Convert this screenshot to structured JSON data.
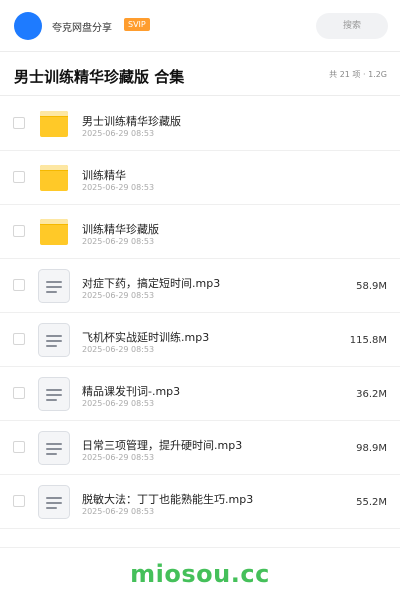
{
  "header": {
    "user_name": "夸克网盘分享",
    "badge": "SVIP",
    "search_placeholder": "搜索"
  },
  "share": {
    "title": "男士训练精华珍藏版 合集",
    "meta": "共 21 项 · 1.2G"
  },
  "files": [
    {
      "type": "folder",
      "name": "男士训练精华珍藏版",
      "date": "2025-06-29 08:53",
      "size": ""
    },
    {
      "type": "folder",
      "name": "训练精华",
      "date": "2025-06-29 08:53",
      "size": ""
    },
    {
      "type": "folder",
      "name": "训练精华珍藏版",
      "date": "2025-06-29 08:53",
      "size": ""
    },
    {
      "type": "file",
      "name": "对症下药，搞定短时间.mp3",
      "date": "2025-06-29 08:53",
      "size": "58.9M"
    },
    {
      "type": "file",
      "name": "飞机杯实战延时训练.mp3",
      "date": "2025-06-29 08:53",
      "size": "115.8M"
    },
    {
      "type": "file",
      "name": "精品课发刊词-.mp3",
      "date": "2025-06-29 08:53",
      "size": "36.2M"
    },
    {
      "type": "file",
      "name": "日常三项管理，提升硬时间.mp3",
      "date": "2025-06-29 08:53",
      "size": "98.9M"
    },
    {
      "type": "file",
      "name": "脱敏大法：丁丁也能熟能生巧.mp3",
      "date": "2025-06-29 08:53",
      "size": "55.2M"
    }
  ],
  "footer": {
    "watermark": "miosou.cc"
  },
  "colors": {
    "avatar": "#1e7bff",
    "badge": "#ff9d2e",
    "folder": "#ffc928",
    "watermark": "#45c05a"
  }
}
